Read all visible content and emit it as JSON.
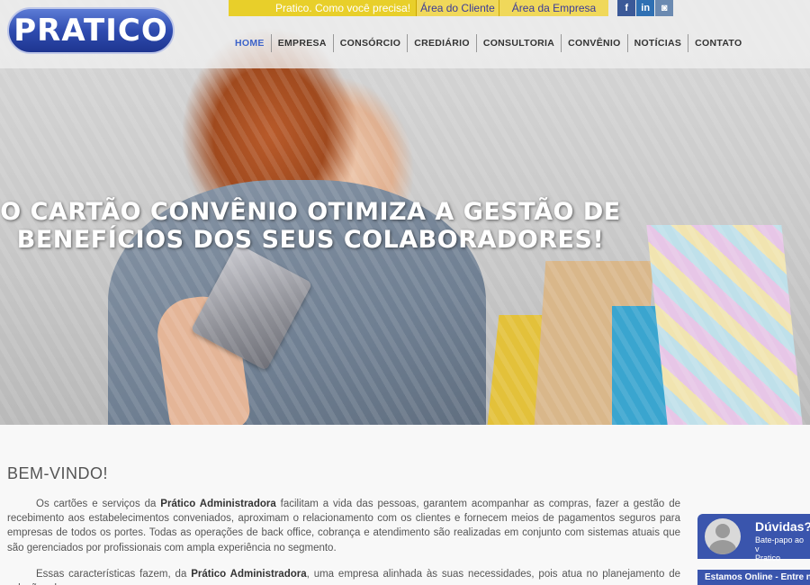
{
  "brand": {
    "logo_text": "PRATICO",
    "accent": "#3d63c9"
  },
  "topbar": {
    "tagline": "Pratico. Como você precisa!",
    "area_cliente": "Área do Cliente",
    "area_empresa": "Área da Empresa",
    "social": {
      "facebook": "f",
      "linkedin": "in",
      "instagram": "◙"
    }
  },
  "nav": {
    "items": [
      "HOME",
      "EMPRESA",
      "CONSÓRCIO",
      "CREDIÁRIO",
      "CONSULTORIA",
      "CONVÊNIO",
      "NOTÍCIAS",
      "CONTATO"
    ]
  },
  "hero": {
    "headline": "O CARTÃO CONVÊNIO OTIMIZA A GESTÃO DE\nBENEFÍCIOS DOS SEUS COLABORADORES!"
  },
  "content": {
    "title": "BEM-VINDO!",
    "p1_before": "Os cartões e serviços da ",
    "p1_bold": "Prático Administradora",
    "p1_after": " facilitam a vida das pessoas, garantem acompanhar as compras, fazer a gestão de recebimento aos estabelecimentos conveniados, aproximam o relacionamento com os clientes e fornecem meios de pagamentos seguros para empresas de todos os portes. Todas as operações de back office, cobrança e atendimento são realizadas em conjunto com sistemas atuais que são gerenciados por profissionais com ampla experiência no segmento.",
    "p2_before": "Essas características fazem, da ",
    "p2_bold": "Prático Administradora",
    "p2_after": ", uma empresa alinhada às suas necessidades, pois atua no planejamento de soluções de"
  },
  "chat": {
    "title": "Dúvidas?",
    "subtitle": "Bate-papo ao v\nPratico",
    "online": "Estamos Online - Entre no"
  }
}
